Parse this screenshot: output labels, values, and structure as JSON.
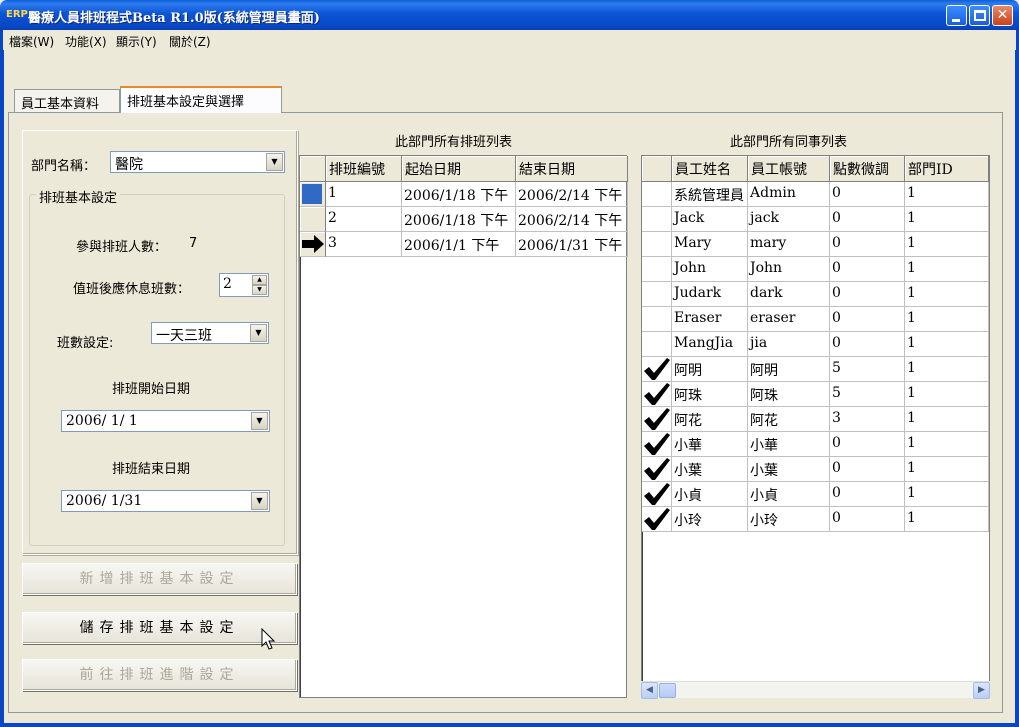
{
  "window": {
    "title": "醫療人員排班程式Beta R1.0版(系統管理員畫面)",
    "icon_text": "ERP"
  },
  "menu": [
    "檔案(W)",
    "功能(X)",
    "顯示(Y)",
    "關於(Z)"
  ],
  "tabs": [
    {
      "label": "員工基本資料",
      "active": false
    },
    {
      "label": "排班基本設定與選擇",
      "active": true
    }
  ],
  "settings": {
    "dept_label": "部門名稱：",
    "dept_value": "醫院",
    "group_title": "排班基本設定",
    "participants_label": "參與排班人數：",
    "participants_value": "7",
    "rest_label": "值班後應休息班數：",
    "rest_value": "2",
    "shift_label": "班數設定:",
    "shift_value": "一天三班",
    "start_label": "排班開始日期",
    "start_value": "2006/ 1/ 1",
    "end_label": "排班結束日期",
    "end_value": "2006/ 1/31"
  },
  "buttons": {
    "add": "新增排班基本設定",
    "save": "儲存排班基本設定",
    "advanced": "前往排班進階設定"
  },
  "schedule_grid": {
    "title": "此部門所有排班列表",
    "columns": [
      "排班編號",
      "起始日期",
      "結束日期"
    ],
    "rows": [
      {
        "id": "1",
        "start": "2006/1/18 下午",
        "end": "2006/2/14 下午",
        "marker": "selected"
      },
      {
        "id": "2",
        "start": "2006/1/18 下午",
        "end": "2006/2/14 下午",
        "marker": ""
      },
      {
        "id": "3",
        "start": "2006/1/1 下午",
        "end": "2006/1/31 下午",
        "marker": "current"
      }
    ]
  },
  "staff_grid": {
    "title": "此部門所有同事列表",
    "columns": [
      "員工姓名",
      "員工帳號",
      "點數微調",
      "部門ID"
    ],
    "rows": [
      {
        "name": "系統管理員",
        "account": "Admin",
        "points": "0",
        "dept": "1",
        "checked": false
      },
      {
        "name": "Jack",
        "account": "jack",
        "points": "0",
        "dept": "1",
        "checked": false
      },
      {
        "name": "Mary",
        "account": "mary",
        "points": "0",
        "dept": "1",
        "checked": false
      },
      {
        "name": "John",
        "account": "John",
        "points": "0",
        "dept": "1",
        "checked": false
      },
      {
        "name": "Judark",
        "account": "dark",
        "points": "0",
        "dept": "1",
        "checked": false
      },
      {
        "name": "Eraser",
        "account": "eraser",
        "points": "0",
        "dept": "1",
        "checked": false
      },
      {
        "name": "MangJia",
        "account": "jia",
        "points": "0",
        "dept": "1",
        "checked": false
      },
      {
        "name": "阿明",
        "account": "阿明",
        "points": "5",
        "dept": "1",
        "checked": true
      },
      {
        "name": "阿珠",
        "account": "阿珠",
        "points": "5",
        "dept": "1",
        "checked": true
      },
      {
        "name": "阿花",
        "account": "阿花",
        "points": "3",
        "dept": "1",
        "checked": true
      },
      {
        "name": "小華",
        "account": "小華",
        "points": "0",
        "dept": "1",
        "checked": true
      },
      {
        "name": "小葉",
        "account": "小葉",
        "points": "0",
        "dept": "1",
        "checked": true
      },
      {
        "name": "小貞",
        "account": "小貞",
        "points": "0",
        "dept": "1",
        "checked": true
      },
      {
        "name": "小玲",
        "account": "小玲",
        "points": "0",
        "dept": "1",
        "checked": true
      }
    ]
  },
  "colors": {
    "titlebar": "#0846c4",
    "selection": "#316ac5",
    "face": "#ece9d8"
  }
}
